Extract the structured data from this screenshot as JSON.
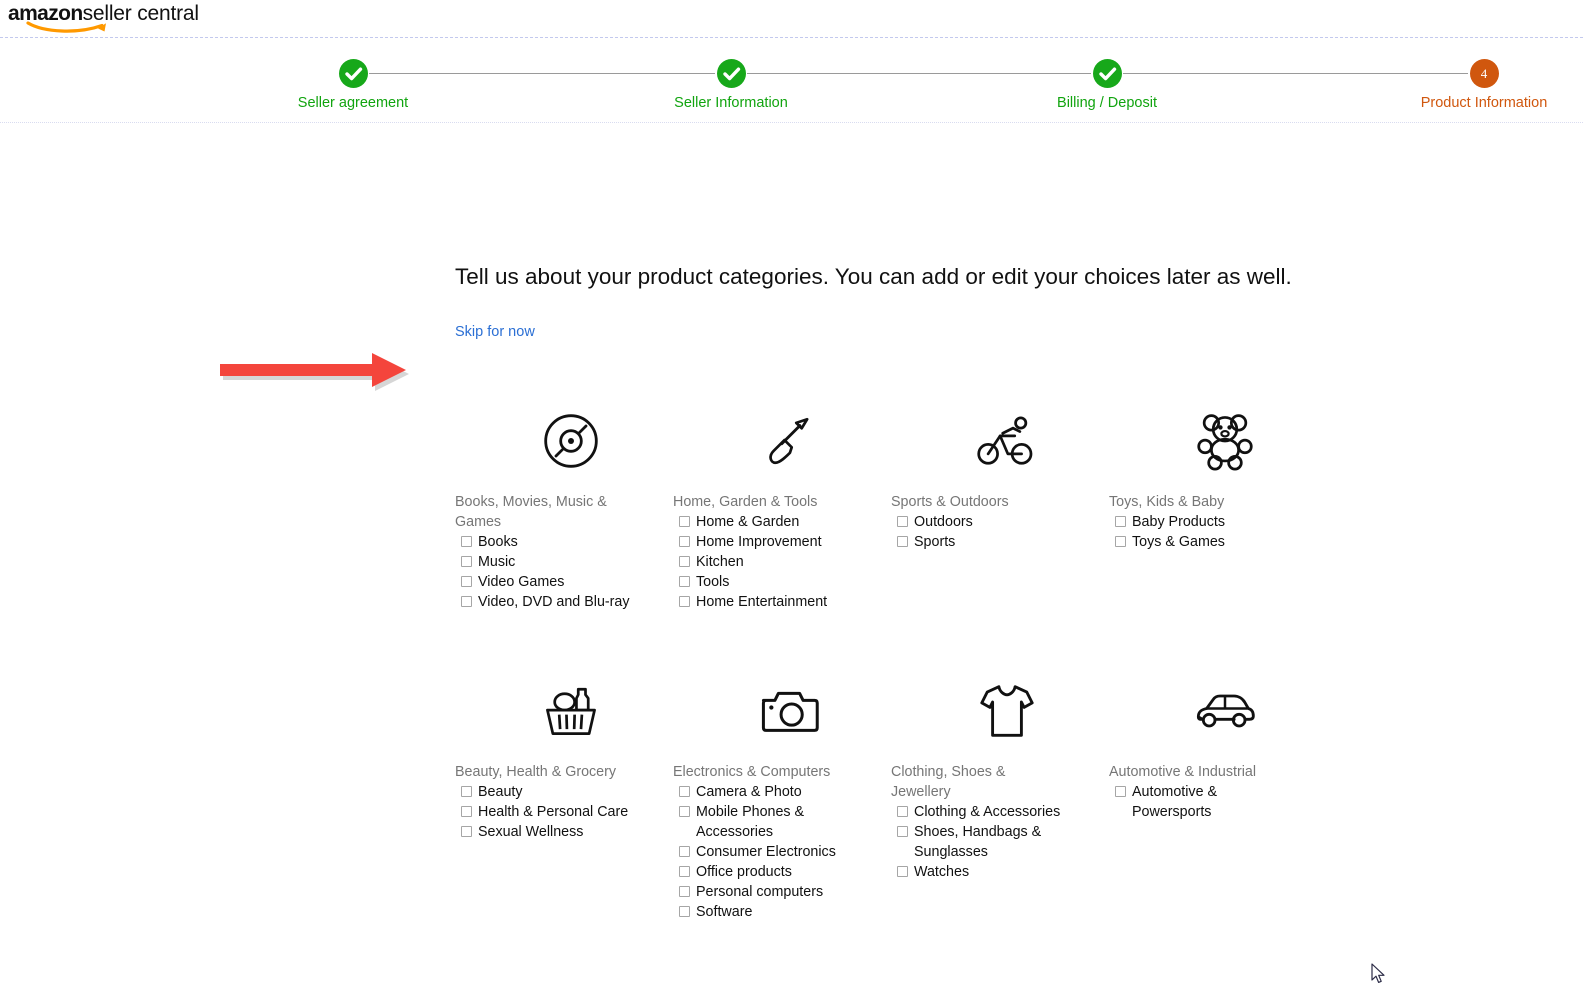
{
  "brand": {
    "logo_bold": "amazon",
    "logo_light": "seller central",
    "logo_swoosh_color": "#ff9900"
  },
  "stepper": {
    "done_color": "#17a81a",
    "current_color": "#d0570e",
    "steps": [
      {
        "label": "Seller agreement",
        "state": "done",
        "number": "1",
        "mark": "check"
      },
      {
        "label": "Seller Information",
        "state": "done",
        "number": "2",
        "mark": "check"
      },
      {
        "label": "Billing / Deposit",
        "state": "done",
        "number": "3",
        "mark": "check"
      },
      {
        "label": "Product Information",
        "state": "current",
        "number": "4",
        "mark": "number"
      }
    ]
  },
  "main": {
    "headline": "Tell us about your product categories. You can add or edit your choices later as well.",
    "skip_label": "Skip for now",
    "skip_link_color": "#2b6fd4",
    "annotation": {
      "type": "arrow-right",
      "color": "#f4453c",
      "points_to": "Skip for now"
    }
  },
  "categories": [
    {
      "title": "Books, Movies, Music & Games",
      "icon": "compact-disc-icon",
      "items": [
        {
          "label": "Books",
          "checked": false
        },
        {
          "label": "Music",
          "checked": false
        },
        {
          "label": "Video Games",
          "checked": false
        },
        {
          "label": "Video, DVD and Blu-ray",
          "checked": false
        }
      ]
    },
    {
      "title": "Home, Garden & Tools",
      "icon": "shovel-icon",
      "items": [
        {
          "label": "Home & Garden",
          "checked": false
        },
        {
          "label": "Home Improvement",
          "checked": false
        },
        {
          "label": "Kitchen",
          "checked": false
        },
        {
          "label": "Tools",
          "checked": false
        },
        {
          "label": "Home Entertainment",
          "checked": false
        }
      ]
    },
    {
      "title": "Sports & Outdoors",
      "icon": "cyclist-icon",
      "items": [
        {
          "label": "Outdoors",
          "checked": false
        },
        {
          "label": "Sports",
          "checked": false
        }
      ]
    },
    {
      "title": "Toys, Kids & Baby",
      "icon": "teddy-bear-icon",
      "items": [
        {
          "label": "Baby Products",
          "checked": false
        },
        {
          "label": "Toys & Games",
          "checked": false
        }
      ]
    },
    {
      "title": "Beauty, Health & Grocery",
      "icon": "grocery-basket-icon",
      "items": [
        {
          "label": "Beauty",
          "checked": false
        },
        {
          "label": "Health & Personal Care",
          "checked": false
        },
        {
          "label": "Sexual Wellness",
          "checked": false
        }
      ]
    },
    {
      "title": "Electronics & Computers",
      "icon": "camera-icon",
      "items": [
        {
          "label": "Camera & Photo",
          "checked": false
        },
        {
          "label": "Mobile Phones & Accessories",
          "checked": false
        },
        {
          "label": "Consumer Electronics",
          "checked": false
        },
        {
          "label": "Office products",
          "checked": false
        },
        {
          "label": "Personal computers",
          "checked": false
        },
        {
          "label": "Software",
          "checked": false
        }
      ]
    },
    {
      "title": "Clothing, Shoes & Jewellery",
      "icon": "tshirt-icon",
      "items": [
        {
          "label": "Clothing & Accessories",
          "checked": false
        },
        {
          "label": "Shoes, Handbags & Sunglasses",
          "checked": false
        },
        {
          "label": "Watches",
          "checked": false
        }
      ]
    },
    {
      "title": "Automotive & Industrial",
      "icon": "car-icon",
      "items": [
        {
          "label": "Automotive & Powersports",
          "checked": false
        }
      ]
    }
  ]
}
